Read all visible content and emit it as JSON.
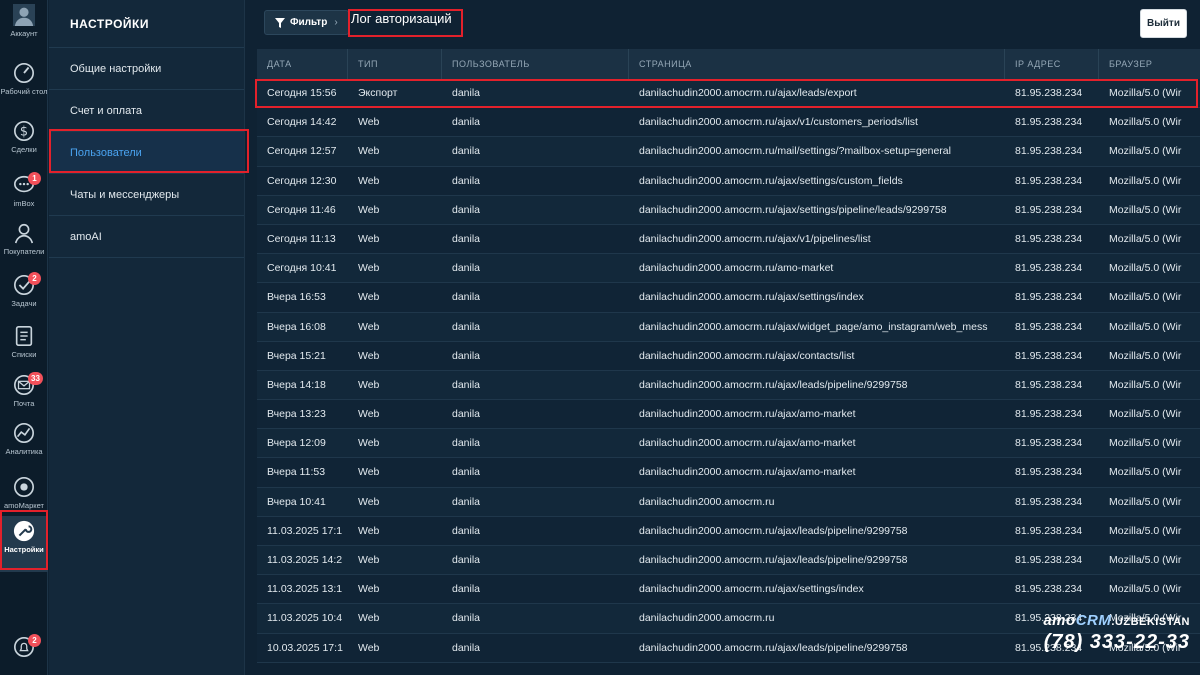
{
  "rail": [
    {
      "label": "Аккаунт",
      "icon": "avatar-icon",
      "badge": ""
    },
    {
      "label": "Рабочий стол",
      "icon": "speedometer-icon",
      "badge": ""
    },
    {
      "label": "Сделки",
      "icon": "dollar-icon",
      "badge": ""
    },
    {
      "label": "imBox",
      "icon": "chat-icon",
      "badge": "1"
    },
    {
      "label": "Покупатели",
      "icon": "customers-icon",
      "badge": ""
    },
    {
      "label": "Задачи",
      "icon": "check-icon",
      "badge": "2"
    },
    {
      "label": "Списки",
      "icon": "list-icon",
      "badge": ""
    },
    {
      "label": "Почта",
      "icon": "mail-icon",
      "badge": "33"
    },
    {
      "label": "Аналитика",
      "icon": "analytics-icon",
      "badge": ""
    },
    {
      "label": "amoМаркет",
      "icon": "market-icon",
      "badge": ""
    },
    {
      "label": "Настройки",
      "icon": "wrench-icon",
      "badge": ""
    },
    {
      "label": "",
      "icon": "bell-icon",
      "badge": "2"
    }
  ],
  "settings": {
    "title": "НАСТРОЙКИ",
    "items": [
      "Общие настройки",
      "Счет и оплата",
      "Пользователи",
      "Чаты и мессенджеры",
      "amoAI"
    ]
  },
  "topbar": {
    "filter_label": "Фильтр",
    "page_title": "Лог авторизаций",
    "logout_label": "Выйти"
  },
  "table": {
    "columns": [
      "ДАТА",
      "ТИП",
      "ПОЛЬЗОВАТЕЛЬ",
      "СТРАНИЦА",
      "IP АДРЕС",
      "БРАУЗЕР"
    ],
    "rows": [
      [
        "Сегодня 15:56",
        "Экспорт",
        "danila",
        "danilachudin2000.amocrm.ru/ajax/leads/export",
        "81.95.238.234",
        "Mozilla/5.0 (Wir"
      ],
      [
        "Сегодня 14:42",
        "Web",
        "danila",
        "danilachudin2000.amocrm.ru/ajax/v1/customers_periods/list",
        "81.95.238.234",
        "Mozilla/5.0 (Wir"
      ],
      [
        "Сегодня 12:57",
        "Web",
        "danila",
        "danilachudin2000.amocrm.ru/mail/settings/?mailbox-setup=general",
        "81.95.238.234",
        "Mozilla/5.0 (Wir"
      ],
      [
        "Сегодня 12:30",
        "Web",
        "danila",
        "danilachudin2000.amocrm.ru/ajax/settings/custom_fields",
        "81.95.238.234",
        "Mozilla/5.0 (Wir"
      ],
      [
        "Сегодня 11:46",
        "Web",
        "danila",
        "danilachudin2000.amocrm.ru/ajax/settings/pipeline/leads/9299758",
        "81.95.238.234",
        "Mozilla/5.0 (Wir"
      ],
      [
        "Сегодня 11:13",
        "Web",
        "danila",
        "danilachudin2000.amocrm.ru/ajax/v1/pipelines/list",
        "81.95.238.234",
        "Mozilla/5.0 (Wir"
      ],
      [
        "Сегодня 10:41",
        "Web",
        "danila",
        "danilachudin2000.amocrm.ru/amo-market",
        "81.95.238.234",
        "Mozilla/5.0 (Wir"
      ],
      [
        "Вчера 16:53",
        "Web",
        "danila",
        "danilachudin2000.amocrm.ru/ajax/settings/index",
        "81.95.238.234",
        "Mozilla/5.0 (Wir"
      ],
      [
        "Вчера 16:08",
        "Web",
        "danila",
        "danilachudin2000.amocrm.ru/ajax/widget_page/amo_instagram/web_mess",
        "81.95.238.234",
        "Mozilla/5.0 (Wir"
      ],
      [
        "Вчера 15:21",
        "Web",
        "danila",
        "danilachudin2000.amocrm.ru/ajax/contacts/list",
        "81.95.238.234",
        "Mozilla/5.0 (Wir"
      ],
      [
        "Вчера 14:18",
        "Web",
        "danila",
        "danilachudin2000.amocrm.ru/ajax/leads/pipeline/9299758",
        "81.95.238.234",
        "Mozilla/5.0 (Wir"
      ],
      [
        "Вчера 13:23",
        "Web",
        "danila",
        "danilachudin2000.amocrm.ru/ajax/amo-market",
        "81.95.238.234",
        "Mozilla/5.0 (Wir"
      ],
      [
        "Вчера 12:09",
        "Web",
        "danila",
        "danilachudin2000.amocrm.ru/ajax/amo-market",
        "81.95.238.234",
        "Mozilla/5.0 (Wir"
      ],
      [
        "Вчера 11:53",
        "Web",
        "danila",
        "danilachudin2000.amocrm.ru/ajax/amo-market",
        "81.95.238.234",
        "Mozilla/5.0 (Wir"
      ],
      [
        "Вчера 10:41",
        "Web",
        "danila",
        "danilachudin2000.amocrm.ru",
        "81.95.238.234",
        "Mozilla/5.0 (Wir"
      ],
      [
        "11.03.2025 17:1",
        "Web",
        "danila",
        "danilachudin2000.amocrm.ru/ajax/leads/pipeline/9299758",
        "81.95.238.234",
        "Mozilla/5.0 (Wir"
      ],
      [
        "11.03.2025 14:2",
        "Web",
        "danila",
        "danilachudin2000.amocrm.ru/ajax/leads/pipeline/9299758",
        "81.95.238.234",
        "Mozilla/5.0 (Wir"
      ],
      [
        "11.03.2025 13:1",
        "Web",
        "danila",
        "danilachudin2000.amocrm.ru/ajax/settings/index",
        "81.95.238.234",
        "Mozilla/5.0 (Wir"
      ],
      [
        "11.03.2025 10:4",
        "Web",
        "danila",
        "danilachudin2000.amocrm.ru",
        "81.95.238.234",
        "Mozilla/5.0 (Wir"
      ],
      [
        "10.03.2025 17:1",
        "Web",
        "danila",
        "danilachudin2000.amocrm.ru/ajax/leads/pipeline/9299758",
        "81.95.238.234",
        "Mozilla/5.0 (Wir"
      ]
    ]
  },
  "watermark": {
    "brand_amo": "amo",
    "brand_crm": "CRM",
    "brand_country": ".UZBEKISTAN",
    "phone": "(78) 333-22-33"
  },
  "colors": {
    "highlight": "#e3212b",
    "active_link": "#4aa3f0",
    "badge": "#f2505a"
  }
}
